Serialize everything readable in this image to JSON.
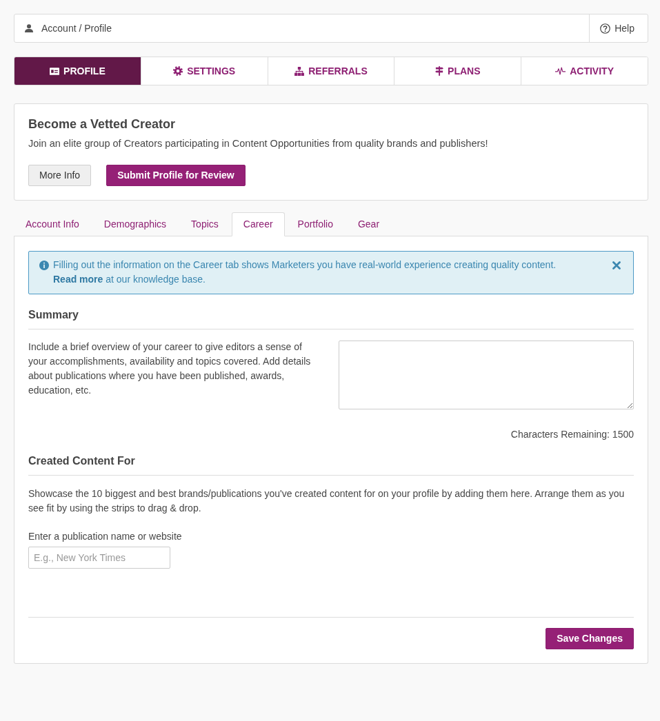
{
  "breadcrumb": {
    "path": "Account / Profile",
    "help": "Help"
  },
  "main_tabs": [
    {
      "label": "PROFILE",
      "selected": true
    },
    {
      "label": "SETTINGS",
      "selected": false
    },
    {
      "label": "REFERRALS",
      "selected": false
    },
    {
      "label": "PLANS",
      "selected": false
    },
    {
      "label": "ACTIVITY",
      "selected": false
    }
  ],
  "vetted_creator": {
    "title": "Become a Vetted Creator",
    "description": "Join an elite group of Creators participating in Content Opportunities from quality brands and publishers!",
    "buttons": [
      {
        "label": "More Info",
        "kind": "secondary"
      },
      {
        "label": "Submit Profile for Review",
        "kind": "primary"
      }
    ]
  },
  "profile_tabs": [
    {
      "label": "Account Info",
      "selected": false
    },
    {
      "label": "Demographics",
      "selected": false
    },
    {
      "label": "Topics",
      "selected": false
    },
    {
      "label": "Career",
      "selected": true
    },
    {
      "label": "Portfolio",
      "selected": false
    },
    {
      "label": "Gear",
      "selected": false
    }
  ],
  "alert": {
    "text": "Filling out the information on the Career tab shows Marketers you have real-world experience creating quality content.",
    "link": "Read more",
    "link_suffix": "at our knowledge base."
  },
  "summary": {
    "heading": "Summary",
    "description": "Include a brief overview of your career to give editors a sense of your accomplishments, availability and topics covered. Add details about publications where you have been published, awards, education, etc.",
    "characters_remaining": "Characters Remaining: 1500"
  },
  "created_content_for": {
    "heading": "Created Content For",
    "description": "Showcase the 10 biggest and best brands/publications you've created content for on your profile by adding them here. Arrange them as you see fit by using the strips to drag & drop.",
    "field_label": "Enter a publication name or website",
    "placeholder": "E.g., New York Times"
  },
  "save_button": "Save Changes"
}
